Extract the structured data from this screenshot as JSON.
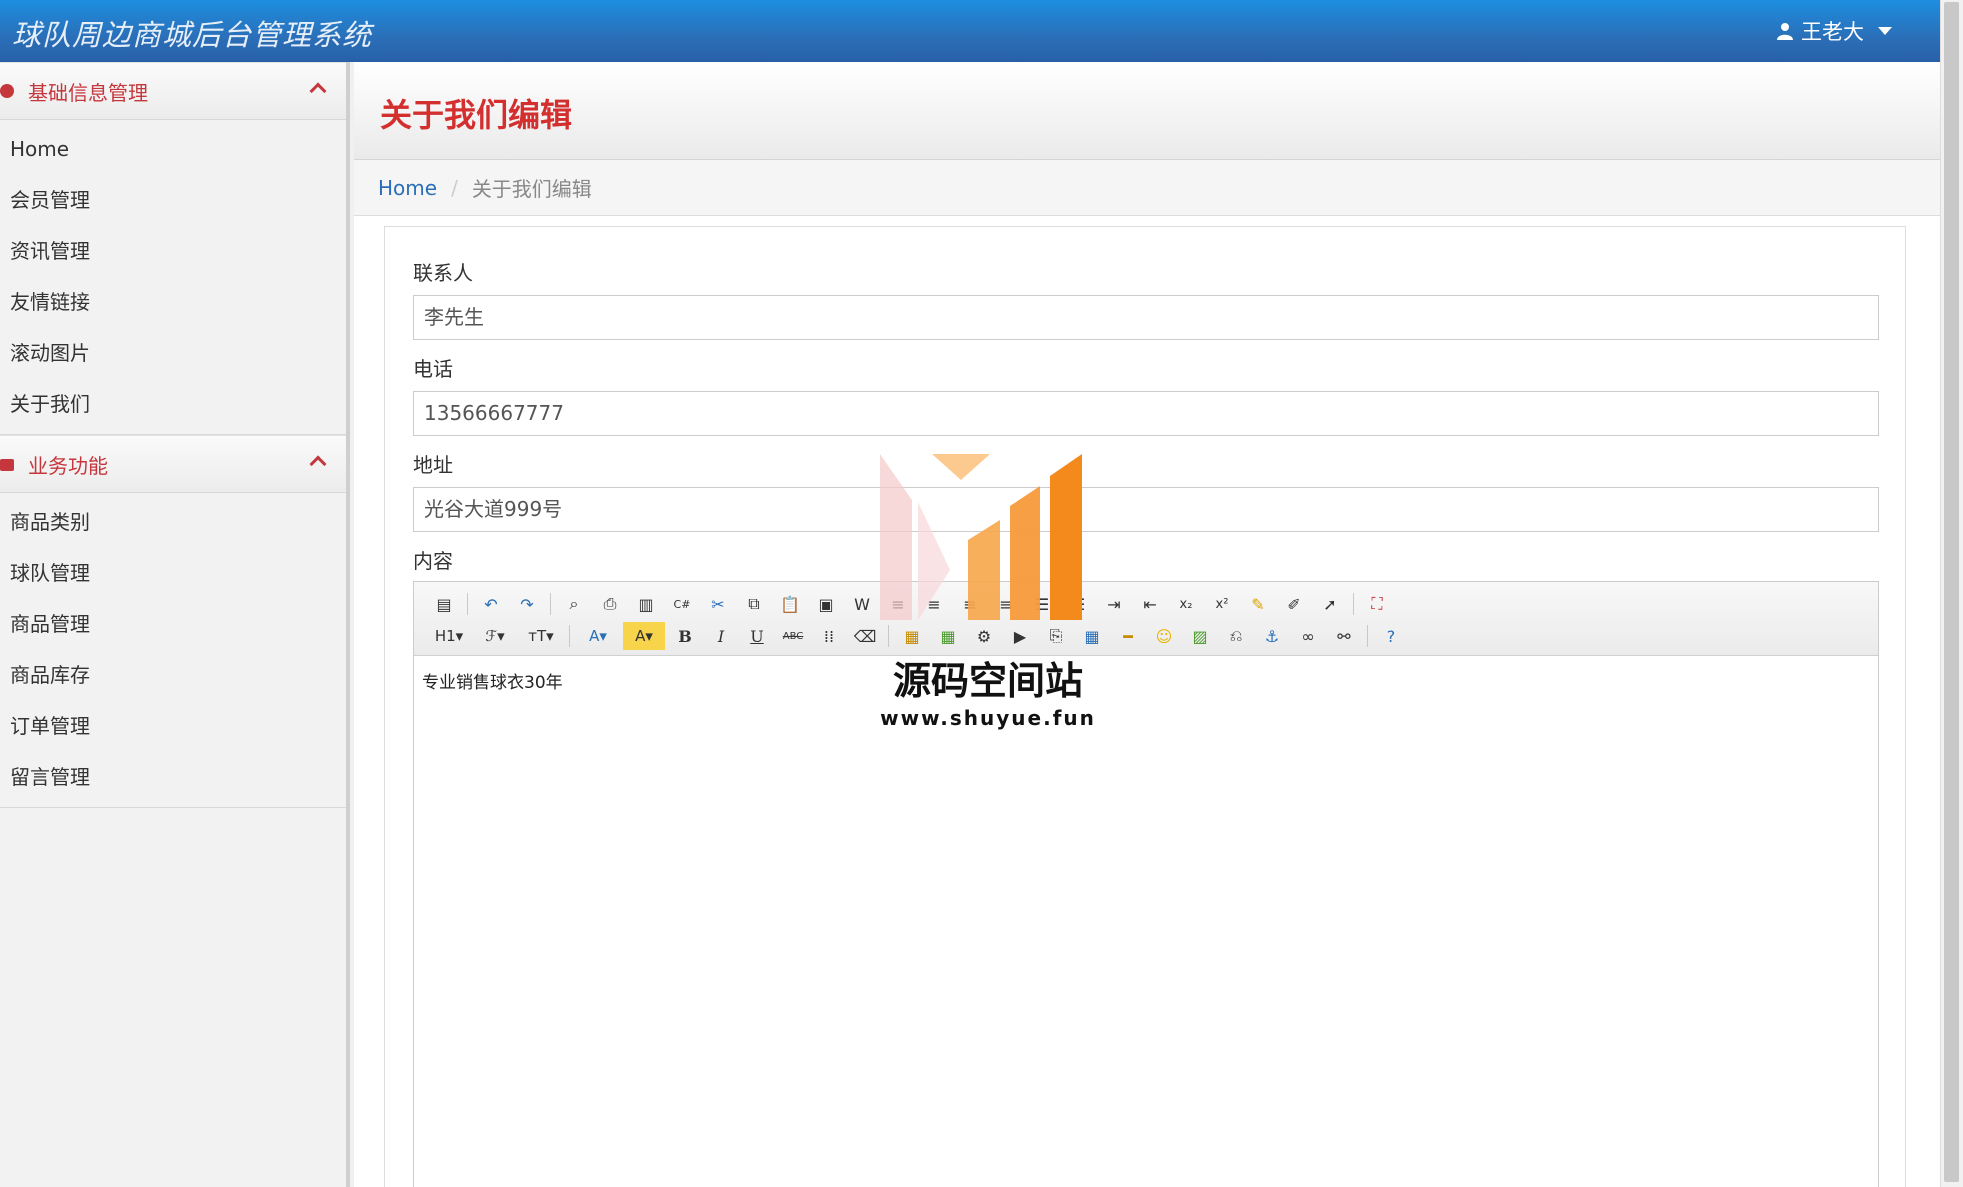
{
  "header": {
    "title": "球队周边商城后台管理系统",
    "user_name": "王老大"
  },
  "sidebar": {
    "groups": [
      {
        "title": "基础信息管理",
        "items": [
          "Home",
          "会员管理",
          "资讯管理",
          "友情链接",
          "滚动图片",
          "关于我们"
        ]
      },
      {
        "title": "业务功能",
        "items": [
          "商品类别",
          "球队管理",
          "商品管理",
          "商品库存",
          "订单管理",
          "留言管理"
        ]
      }
    ]
  },
  "page": {
    "title": "关于我们编辑",
    "breadcrumb": {
      "home": "Home",
      "current": "关于我们编辑"
    }
  },
  "form": {
    "contact_label": "联系人",
    "contact_value": "李先生",
    "phone_label": "电话",
    "phone_value": "13566667777",
    "address_label": "地址",
    "address_value": "光谷大道999号",
    "content_label": "内容",
    "content_value": "专业销售球衣30年"
  },
  "watermark": {
    "text": "源码空间站",
    "url": "www.shuyue.fun"
  },
  "colors": {
    "accent_red": "#d32f2f",
    "topbar_blue": "#2a6fb8",
    "link_blue": "#2a6fb8"
  }
}
